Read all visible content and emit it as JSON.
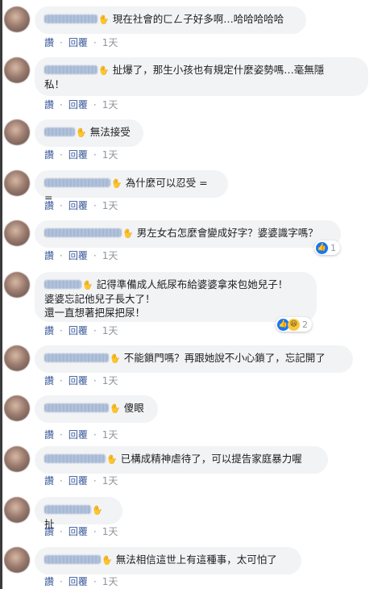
{
  "actions": {
    "like": "讚",
    "reply": "回覆",
    "time": "1天"
  },
  "comments": [
    {
      "text": "現在社會的ㄈㄥ子好多啊…哈哈哈哈哈"
    },
    {
      "text": "扯爆了，那生小孩也有規定什麼姿勢嗎…毫無隱",
      "text2": "私！"
    },
    {
      "text": "無法接受"
    },
    {
      "text": "為什麼可以忍受 = ="
    },
    {
      "text": "男左女右怎麼會變成好字？婆婆識字嗎？",
      "reaction_icons": [
        "like-icon"
      ],
      "reaction_count": "1"
    },
    {
      "text": "記得準備成人紙尿布給婆婆拿來包她兒子！",
      "text2": "婆婆忘記他兒子長大了！",
      "text3": "還一直想著把屎把尿！",
      "reaction_icons": [
        "like-icon",
        "haha-icon"
      ],
      "reaction_count": "2"
    },
    {
      "text": "不能鎖門嗎？再跟她說不小心鎖了，忘記開了"
    },
    {
      "text": "傻眼"
    },
    {
      "text": "已構成精神虐待了，可以提告家庭暴力喔"
    },
    {
      "text": "扯"
    },
    {
      "text": "無法相信這世上有這種事，太可怕了"
    }
  ]
}
